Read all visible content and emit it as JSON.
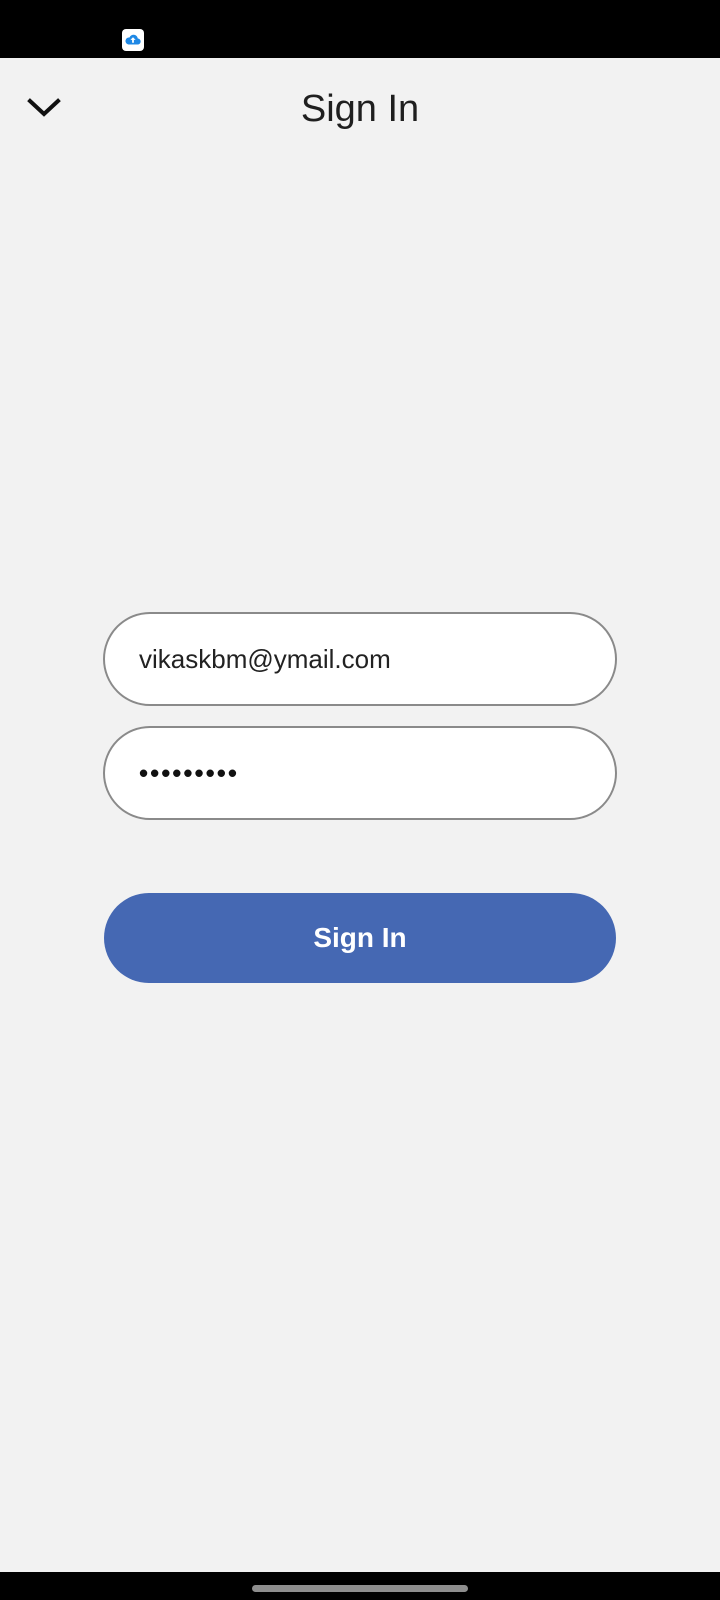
{
  "status_bar": {
    "app_icon": "cloud-upload-icon",
    "app_icon_color": "#1e88e5"
  },
  "header": {
    "back_icon": "chevron-down-icon",
    "title": "Sign In"
  },
  "form": {
    "email_value": "vikaskbm@ymail.com",
    "password_masked": "•••••••••",
    "submit_label": "Sign In",
    "submit_color": "#4568b3"
  }
}
